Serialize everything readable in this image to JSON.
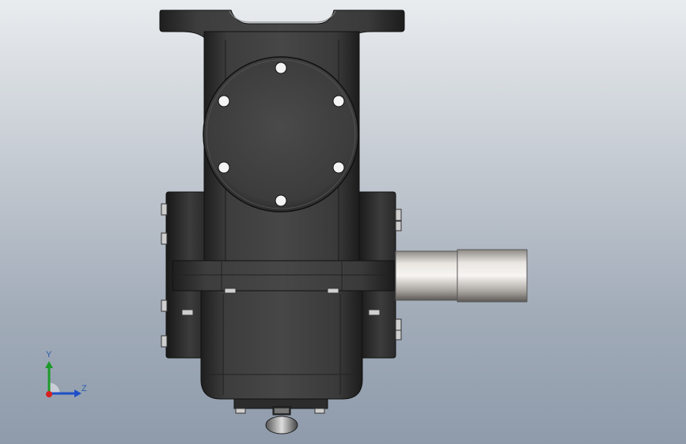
{
  "triad": {
    "y_label": "Y",
    "z_label": "Z",
    "x_color": "#d82020",
    "y_color": "#1d9a2a",
    "z_color": "#1f4fc8"
  },
  "model": {
    "body_color": "#3a3a3a",
    "shaft_color": "#cfcac4"
  }
}
